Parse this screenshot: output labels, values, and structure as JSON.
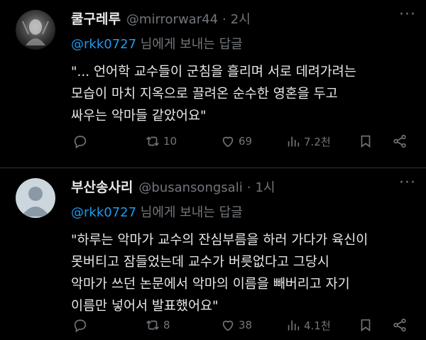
{
  "tweets": [
    {
      "display_name": "쿨구레루",
      "handle": "@mirrorwar44",
      "separator": "·",
      "time": "2시",
      "more_icon": "···",
      "reply_to_handle": "@rkk0727",
      "reply_suffix": " 님에게 보내는 답글",
      "body_lines": [
        "\"... 언어학 교수들이 군침을 흘리며 서로 데려가려는",
        "모습이 마치 지옥으로 끌려온 순수한 영혼을 두고",
        "싸우는 악마들 같았어요\""
      ],
      "stats": {
        "retweets": "10",
        "likes": "69",
        "views": "7.2천"
      }
    },
    {
      "display_name": "부산송사리",
      "handle": "@busansongsali",
      "separator": "·",
      "time": "1시",
      "more_icon": "···",
      "reply_to_handle": "@rkk0727",
      "reply_suffix": " 님에게 보내는 답글",
      "body_lines": [
        "\"하루는 악마가 교수의 잔심부름을 하러 가다가 육신이",
        "못버티고 잠들었는데 교수가 버릇없다고 그당시",
        "악마가 쓰던 논문에서 악마의 이름을 빼버리고  자기",
        "이름만 넣어서 발표했어요\""
      ],
      "stats": {
        "retweets": "8",
        "likes": "38",
        "views": "4.1천"
      }
    }
  ],
  "icons": [
    "reply-icon",
    "retweet-icon",
    "like-icon",
    "views-icon",
    "bookmark-icon",
    "share-icon",
    "more-icon"
  ],
  "colors": {
    "background": "#000000",
    "text": "#e7e9ea",
    "muted": "#71767b",
    "link": "#1d9bf0",
    "divider": "#2f3336"
  }
}
